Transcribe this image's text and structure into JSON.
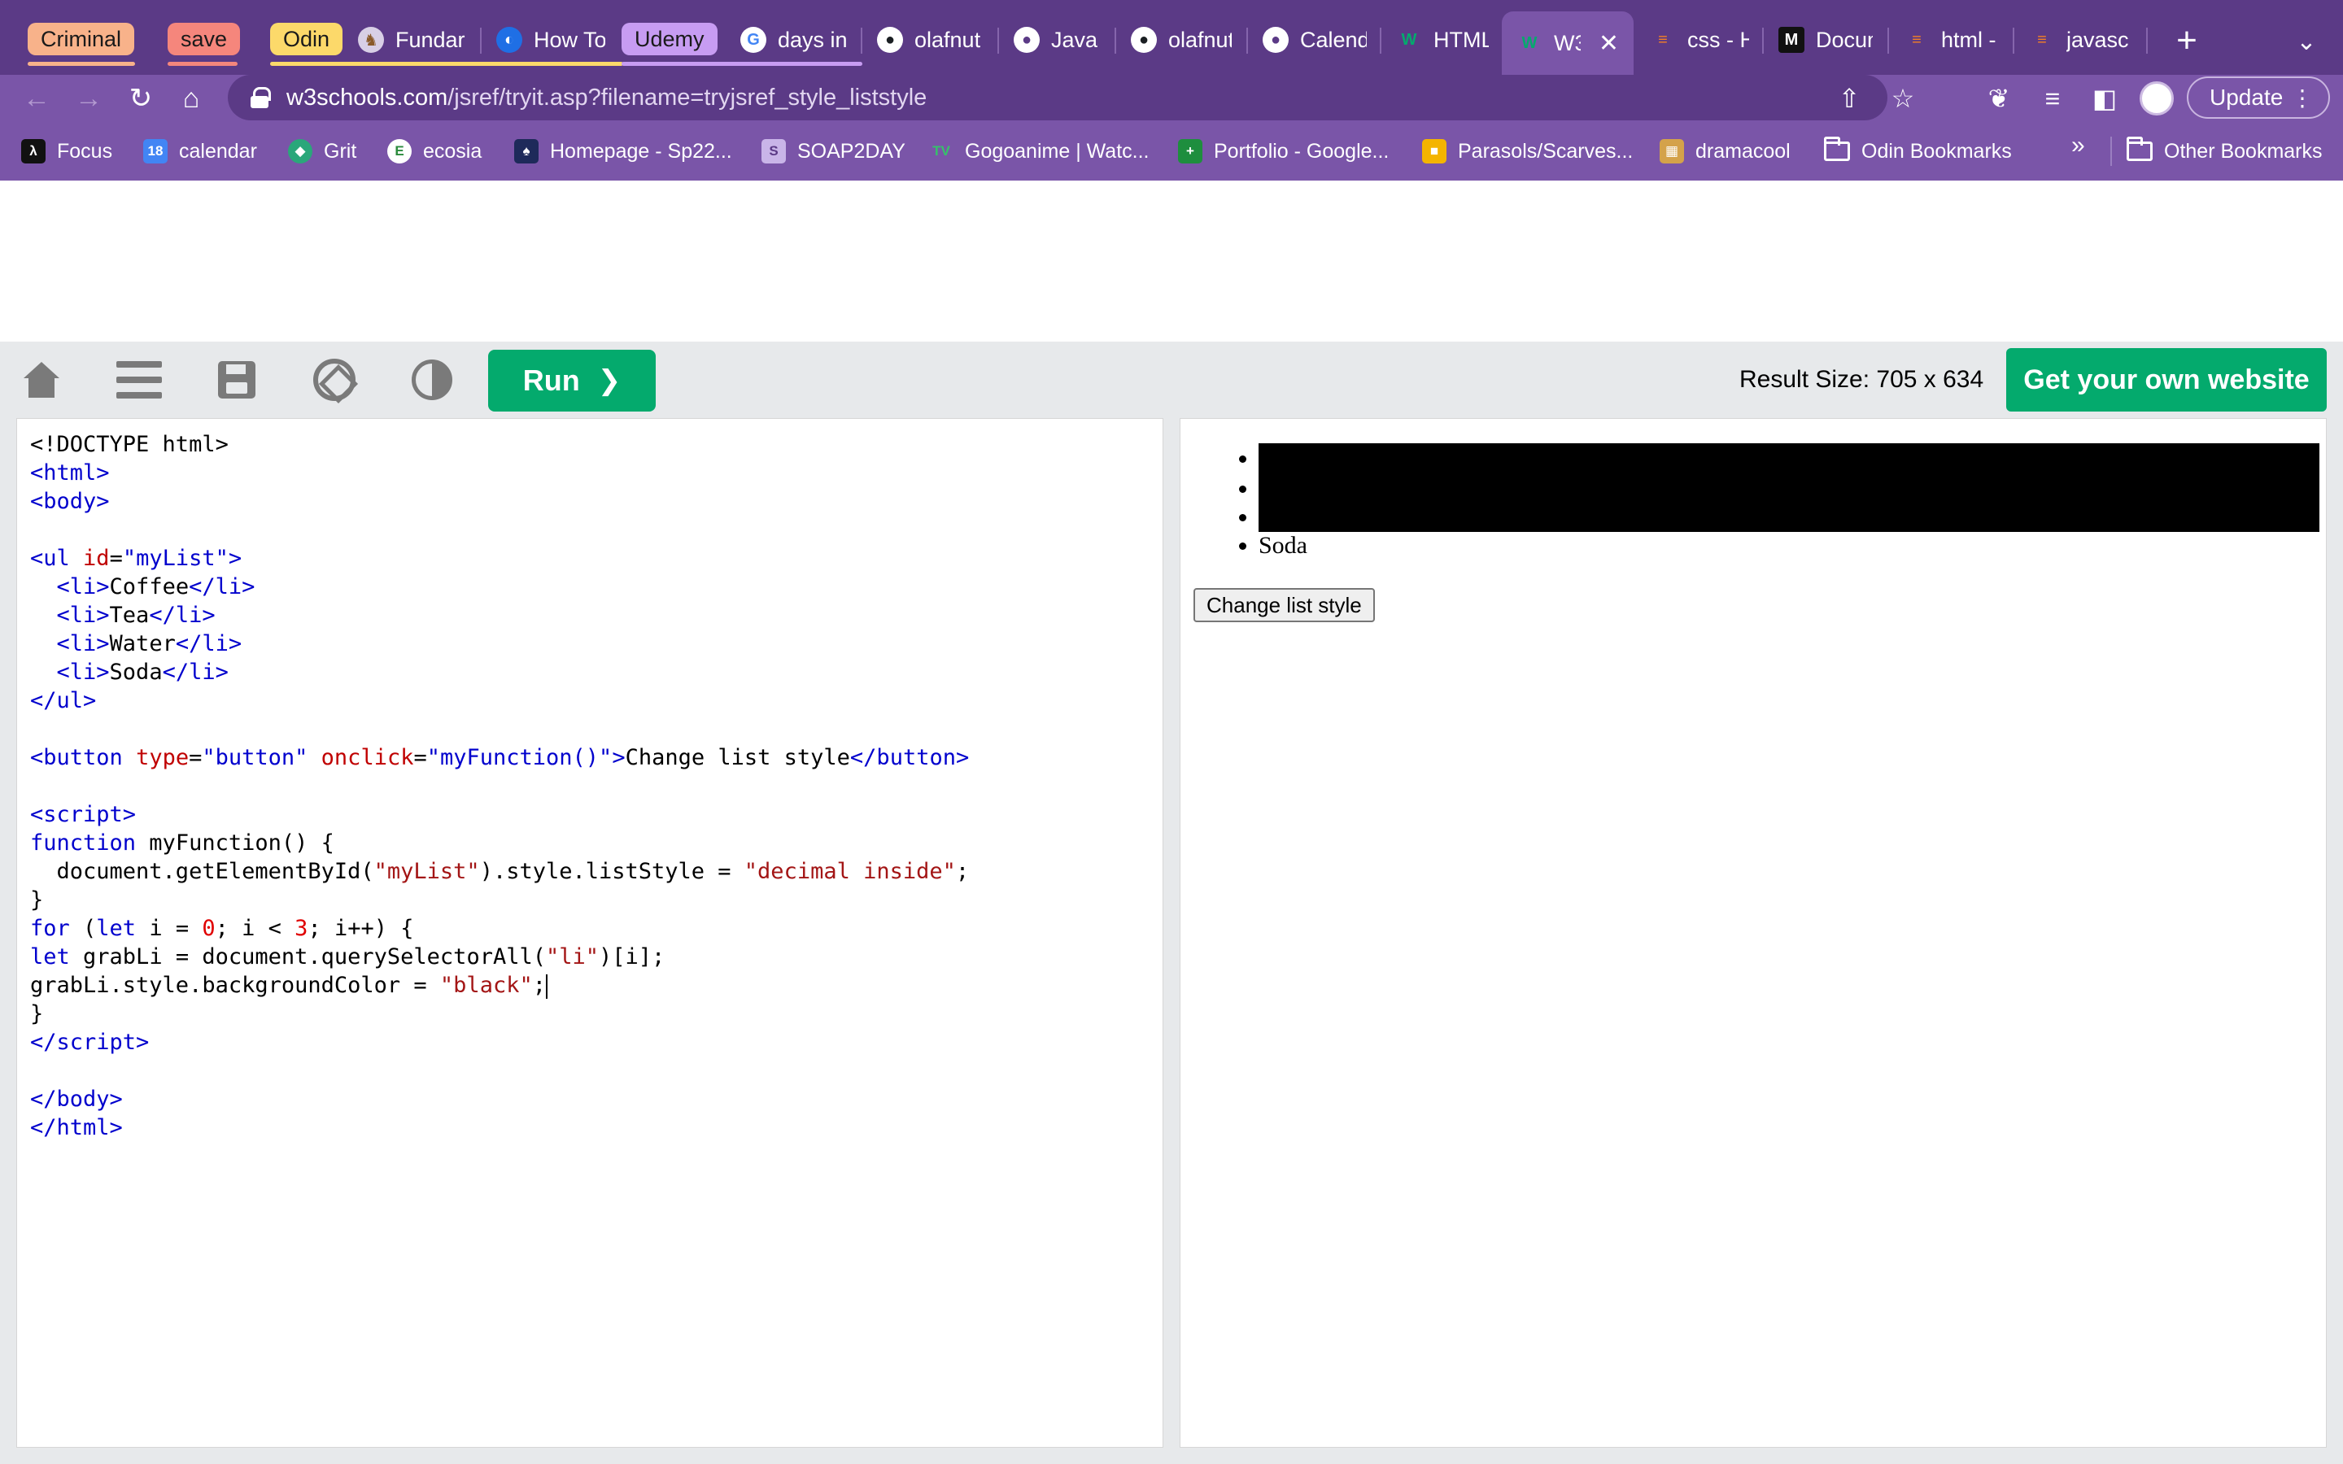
{
  "browser": {
    "tabs": [
      {
        "group": "Criminal",
        "group_color": "#f8b28a"
      },
      {
        "group": "save",
        "group_color": "#f5867c"
      },
      {
        "group": "Odin",
        "group_color": "#fcd96a",
        "title": "Fundar"
      },
      {
        "title": "How To"
      },
      {
        "group": "Udemy",
        "group_color": "#c79cf2",
        "title": "days in"
      },
      {
        "title": "olafnut"
      },
      {
        "title": "Javasc"
      },
      {
        "title": "olafnut"
      },
      {
        "title": "Calend"
      },
      {
        "title": "HTML"
      },
      {
        "title": "W3",
        "active": true
      },
      {
        "title": "css - H"
      },
      {
        "title": "Docum"
      },
      {
        "title": "html -"
      },
      {
        "title": "javasc"
      }
    ],
    "url_host": "w3schools.com",
    "url_path": "/jsref/tryit.asp?filename=tryjsref_style_liststyle",
    "update_label": "Update",
    "bookmarks": [
      "Focus",
      "calendar",
      "Grit",
      "ecosia",
      "Homepage - Sp22...",
      "SOAP2DAY",
      "Gogoanime | Watc...",
      "Portfolio - Google...",
      "Parasols/Scarves...",
      "dramacool",
      "Odin Bookmarks",
      "Other Bookmarks"
    ]
  },
  "w3": {
    "run_label": "Run",
    "result_size": "Result Size: 705 x 634",
    "get_site_label": "Get your own website"
  },
  "result": {
    "items": [
      "Coffee",
      "Tea",
      "Water",
      "Soda"
    ],
    "button_label": "Change list style"
  },
  "colors": {
    "browser_frame": "#5b3a86",
    "browser_toolbar": "#7a55a8",
    "w3_green": "#04aa6d"
  }
}
